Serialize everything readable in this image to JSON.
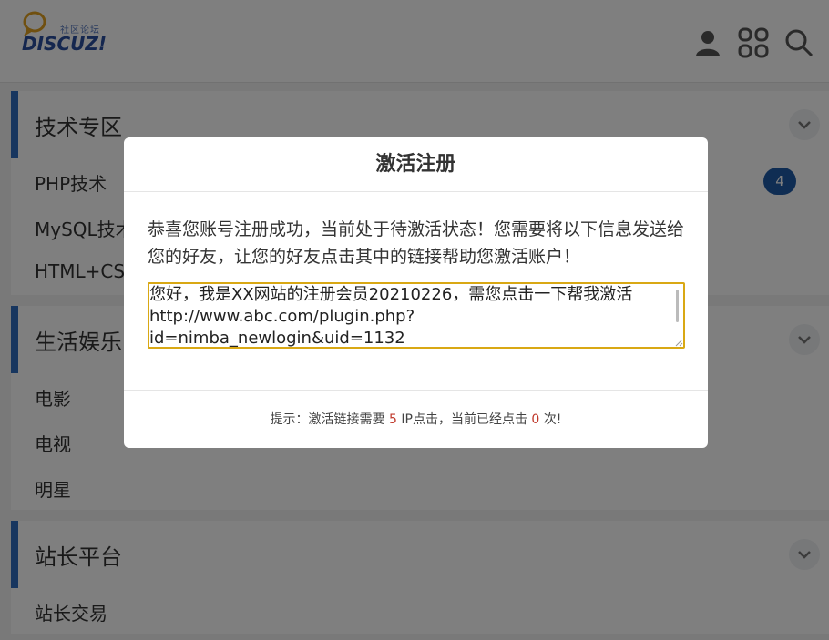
{
  "header": {
    "logo_sub": "社区论坛",
    "logo_text": "DISCUZ!",
    "icons": [
      "user-icon",
      "apps-icon",
      "search-icon"
    ]
  },
  "sections": [
    {
      "title": "技术专区",
      "items": [
        {
          "label": "PHP技术",
          "badge": "4"
        },
        {
          "label": "MySQL技术"
        },
        {
          "label": "HTML+CSS"
        }
      ]
    },
    {
      "title": "生活娱乐",
      "items": [
        {
          "label": "电影"
        },
        {
          "label": "电视"
        },
        {
          "label": "明星"
        }
      ]
    },
    {
      "title": "站长平台",
      "items": [
        {
          "label": "站长交易"
        }
      ]
    }
  ],
  "modal": {
    "title": "激活注册",
    "message": "恭喜您账号注册成功，当前处于待激活状态！您需要将以下信息发送给您的好友，让您的好友点击其中的链接帮助您激活账户！",
    "textarea_value": "您好，我是XX网站的注册会员20210226，需您点击一下帮我激活\nhttp://www.abc.com/plugin.php?\nid=nimba_newlogin&uid=1132",
    "footer_prefix": "提示：激活链接需要",
    "required_clicks": "5",
    "footer_middle": "IP点击，当前已经点击",
    "current_clicks": "0",
    "footer_suffix": "次!"
  },
  "colors": {
    "accent": "#2f6dbf",
    "badge": "#1f5aa6",
    "highlight_number": "#c0392b",
    "textarea_border": "#d9a814"
  }
}
